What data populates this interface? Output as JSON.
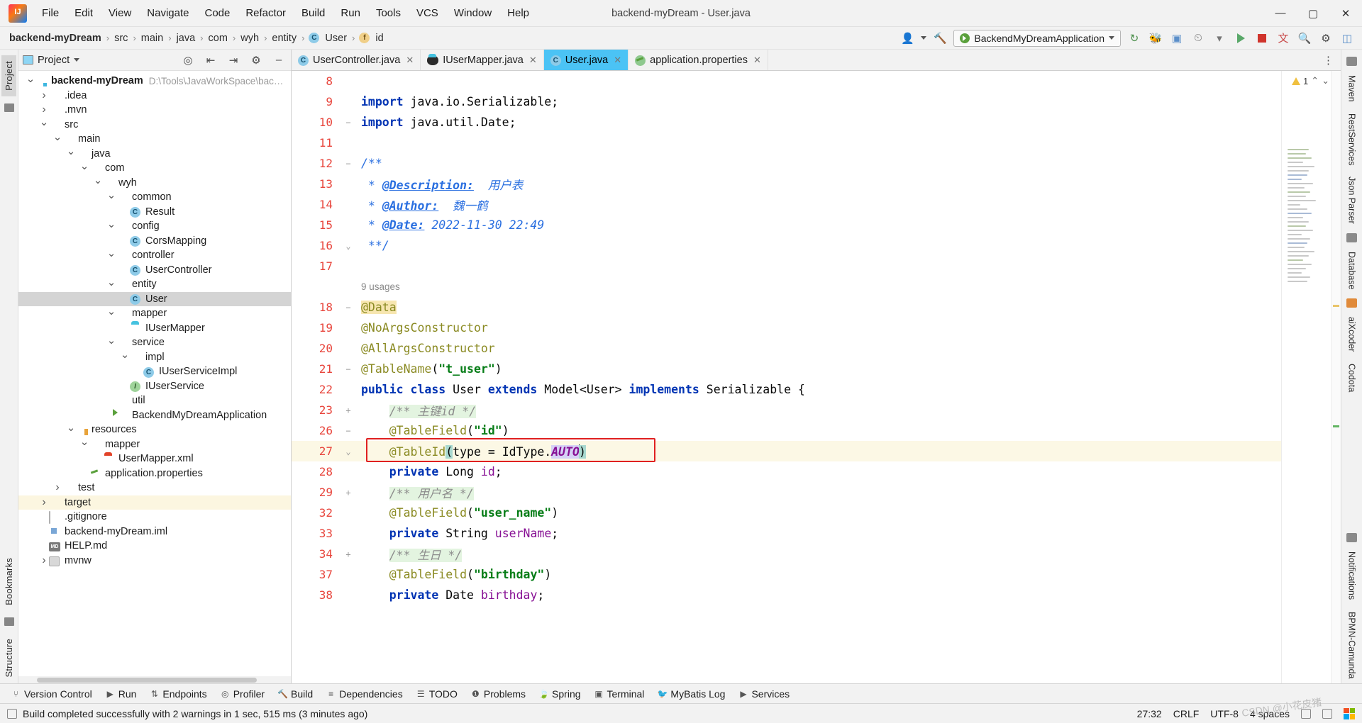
{
  "window": {
    "title": "backend-myDream - User.java",
    "logo_icon": "intellij-idea-logo",
    "minimize": "—",
    "maximize": "▢",
    "close": "✕"
  },
  "menu": [
    "File",
    "Edit",
    "View",
    "Navigate",
    "Code",
    "Refactor",
    "Build",
    "Run",
    "Tools",
    "VCS",
    "Window",
    "Help"
  ],
  "breadcrumb": {
    "items": [
      "backend-myDream",
      "src",
      "main",
      "java",
      "com",
      "wyh",
      "entity",
      "User",
      "id"
    ],
    "user_badge": "C",
    "id_badge": "f"
  },
  "toolbar": {
    "run_config": "BackendMyDreamApplication",
    "icons": [
      "account-icon",
      "hammer-icon",
      "spring-boot-icon",
      "chevron-down-icon",
      "sync-icon",
      "debug-icon",
      "coverage-icon",
      "profiler-icon",
      "run-icon",
      "stop-icon",
      "translate-icon",
      "search-icon",
      "settings-icon",
      "layout-icon"
    ]
  },
  "project_panel": {
    "title": "Project",
    "header_icons": [
      "locate-icon",
      "collapse-all-icon",
      "expand-all-icon",
      "settings-icon",
      "hide-icon"
    ],
    "tree": [
      {
        "depth": 0,
        "arrow": "down",
        "icon": "folder-module",
        "label": "backend-myDream",
        "bold": true,
        "path": "D:\\Tools\\JavaWorkSpace\\backend-my",
        "state": "normal"
      },
      {
        "depth": 1,
        "arrow": "right",
        "icon": "folder",
        "label": ".idea",
        "state": "normal"
      },
      {
        "depth": 1,
        "arrow": "right",
        "icon": "folder",
        "label": ".mvn",
        "state": "normal"
      },
      {
        "depth": 1,
        "arrow": "down",
        "icon": "folder",
        "label": "src",
        "state": "normal"
      },
      {
        "depth": 2,
        "arrow": "down",
        "icon": "folder",
        "label": "main",
        "state": "normal"
      },
      {
        "depth": 3,
        "arrow": "down",
        "icon": "folder-source",
        "label": "java",
        "state": "normal"
      },
      {
        "depth": 4,
        "arrow": "down",
        "icon": "folder-package",
        "label": "com",
        "state": "normal"
      },
      {
        "depth": 5,
        "arrow": "down",
        "icon": "folder-package",
        "label": "wyh",
        "state": "normal"
      },
      {
        "depth": 6,
        "arrow": "down",
        "icon": "folder-package",
        "label": "common",
        "state": "normal"
      },
      {
        "depth": 7,
        "arrow": "none",
        "icon": "class",
        "label": "Result",
        "state": "normal"
      },
      {
        "depth": 6,
        "arrow": "down",
        "icon": "folder-package",
        "label": "config",
        "state": "normal"
      },
      {
        "depth": 7,
        "arrow": "none",
        "icon": "class",
        "label": "CorsMapping",
        "state": "normal"
      },
      {
        "depth": 6,
        "arrow": "down",
        "icon": "folder-package",
        "label": "controller",
        "state": "normal"
      },
      {
        "depth": 7,
        "arrow": "none",
        "icon": "class",
        "label": "UserController",
        "state": "normal"
      },
      {
        "depth": 6,
        "arrow": "down",
        "icon": "folder-package",
        "label": "entity",
        "state": "normal"
      },
      {
        "depth": 7,
        "arrow": "none",
        "icon": "class",
        "label": "User",
        "state": "selected"
      },
      {
        "depth": 6,
        "arrow": "down",
        "icon": "folder-package",
        "label": "mapper",
        "state": "normal"
      },
      {
        "depth": 7,
        "arrow": "none",
        "icon": "mybatis-blue",
        "label": "IUserMapper",
        "state": "normal"
      },
      {
        "depth": 6,
        "arrow": "down",
        "icon": "folder-package",
        "label": "service",
        "state": "normal"
      },
      {
        "depth": 7,
        "arrow": "down",
        "icon": "folder-package",
        "label": "impl",
        "state": "normal"
      },
      {
        "depth": 8,
        "arrow": "none",
        "icon": "class",
        "label": "IUserServiceImpl",
        "state": "normal"
      },
      {
        "depth": 7,
        "arrow": "none",
        "icon": "interface",
        "label": "IUserService",
        "state": "normal"
      },
      {
        "depth": 6,
        "arrow": "none",
        "icon": "folder-package",
        "label": "util",
        "state": "normal"
      },
      {
        "depth": 6,
        "arrow": "none",
        "icon": "spring-app",
        "label": "BackendMyDreamApplication",
        "state": "normal"
      },
      {
        "depth": 3,
        "arrow": "down",
        "icon": "folder-resources",
        "label": "resources",
        "state": "normal"
      },
      {
        "depth": 4,
        "arrow": "down",
        "icon": "folder",
        "label": "mapper",
        "state": "normal"
      },
      {
        "depth": 5,
        "arrow": "none",
        "icon": "mybatis-red",
        "label": "UserMapper.xml",
        "state": "normal"
      },
      {
        "depth": 4,
        "arrow": "none",
        "icon": "properties",
        "label": "application.properties",
        "state": "normal"
      },
      {
        "depth": 2,
        "arrow": "right",
        "icon": "folder",
        "label": "test",
        "state": "normal"
      },
      {
        "depth": 1,
        "arrow": "right",
        "icon": "folder-target",
        "label": "target",
        "state": "highlight"
      },
      {
        "depth": 1,
        "arrow": "none",
        "icon": "gitignore",
        "label": ".gitignore",
        "state": "normal"
      },
      {
        "depth": 1,
        "arrow": "none",
        "icon": "iml",
        "label": "backend-myDream.iml",
        "state": "normal"
      },
      {
        "depth": 1,
        "arrow": "none",
        "icon": "markdown",
        "label": "HELP.md",
        "state": "normal"
      },
      {
        "depth": 1,
        "arrow": "right",
        "icon": "shell",
        "label": "mvnw",
        "state": "normal"
      }
    ]
  },
  "left_rail": {
    "tabs": [
      "Project"
    ],
    "icons": [
      "bookmarks-icon",
      "structure-icon"
    ],
    "bottom_labels": [
      "Bookmarks",
      "Structure"
    ]
  },
  "editor": {
    "tabs": [
      {
        "label": "UserController.java",
        "icon": "class-icon",
        "active": false,
        "closable": true
      },
      {
        "label": "IUserMapper.java",
        "icon": "mybatis-icon",
        "active": false,
        "closable": true
      },
      {
        "label": "User.java",
        "icon": "class-icon",
        "active": true,
        "closable": true
      },
      {
        "label": "application.properties",
        "icon": "properties-icon",
        "active": false,
        "closable": true
      }
    ],
    "warning_count": "1",
    "lines": [
      {
        "num": "8",
        "fold": "",
        "partial": true,
        "tokens": []
      },
      {
        "num": "9",
        "fold": "",
        "tokens": [
          {
            "t": "import ",
            "c": "kw"
          },
          {
            "t": "java.io.Serializable;",
            "c": "plain"
          }
        ]
      },
      {
        "num": "10",
        "fold": "minus",
        "tokens": [
          {
            "t": "import ",
            "c": "kw"
          },
          {
            "t": "java.util.Date;",
            "c": "plain"
          }
        ]
      },
      {
        "num": "11",
        "fold": "",
        "tokens": []
      },
      {
        "num": "12",
        "fold": "minus-top",
        "tokens": [
          {
            "t": "/**",
            "c": "jdoc"
          }
        ]
      },
      {
        "num": "13",
        "fold": "",
        "tokens": [
          {
            "t": " * ",
            "c": "jdoc"
          },
          {
            "t": "@Description:",
            "c": "jdoctag"
          },
          {
            "t": "  用户表",
            "c": "jdoc"
          }
        ]
      },
      {
        "num": "14",
        "fold": "",
        "tokens": [
          {
            "t": " * ",
            "c": "jdoc"
          },
          {
            "t": "@Author:",
            "c": "jdoctag"
          },
          {
            "t": "  魏一鹤",
            "c": "jdoc"
          }
        ]
      },
      {
        "num": "15",
        "fold": "",
        "tokens": [
          {
            "t": " * ",
            "c": "jdoc"
          },
          {
            "t": "@Date:",
            "c": "jdoctag"
          },
          {
            "t": " 2022-11-30 22:49",
            "c": "jdoc"
          }
        ]
      },
      {
        "num": "16",
        "fold": "minus-bot",
        "tokens": [
          {
            "t": " **/",
            "c": "jdoc"
          }
        ]
      },
      {
        "num": "17",
        "fold": "",
        "tokens": []
      },
      {
        "num": "",
        "fold": "",
        "usages": "9 usages"
      },
      {
        "num": "18",
        "fold": "minus-top",
        "tokens": [
          {
            "t": "@Data",
            "c": "ann",
            "bg": "hl-yellow"
          }
        ]
      },
      {
        "num": "19",
        "fold": "",
        "tokens": [
          {
            "t": "@NoArgsConstructor",
            "c": "ann"
          }
        ]
      },
      {
        "num": "20",
        "fold": "",
        "tokens": [
          {
            "t": "@AllArgsConstructor",
            "c": "ann"
          }
        ]
      },
      {
        "num": "21",
        "fold": "minus",
        "tokens": [
          {
            "t": "@TableName",
            "c": "ann"
          },
          {
            "t": "(",
            "c": "plain"
          },
          {
            "t": "\"t_user\"",
            "c": "str"
          },
          {
            "t": ")",
            "c": "plain"
          }
        ]
      },
      {
        "num": "22",
        "fold": "",
        "tokens": [
          {
            "t": "public class ",
            "c": "kw"
          },
          {
            "t": "User ",
            "c": "plain"
          },
          {
            "t": "extends ",
            "c": "kw"
          },
          {
            "t": "Model<User> ",
            "c": "plain"
          },
          {
            "t": "implements ",
            "c": "kw"
          },
          {
            "t": "Serializable {",
            "c": "plain"
          }
        ]
      },
      {
        "num": "23",
        "fold": "plus",
        "indent": 4,
        "tokens": [
          {
            "t": "/** 主键id */",
            "c": "cmt",
            "bg": "hl-green"
          }
        ]
      },
      {
        "num": "26",
        "fold": "minus-top",
        "indent": 4,
        "tokens": [
          {
            "t": "@TableField",
            "c": "ann"
          },
          {
            "t": "(",
            "c": "plain"
          },
          {
            "t": "\"id\"",
            "c": "str"
          },
          {
            "t": ")",
            "c": "plain"
          }
        ]
      },
      {
        "num": "27",
        "fold": "minus-bot",
        "indent": 4,
        "rowbg": "rowbg-y",
        "boxed": true,
        "tokens": [
          {
            "t": "@TableId",
            "c": "ann"
          },
          {
            "t": "(",
            "c": "plain",
            "bg": "hl-teal"
          },
          {
            "t": "type = IdType.",
            "c": "plain"
          },
          {
            "t": "AUTO",
            "c": "fld",
            "bg": "hl-lav",
            "italic": true
          },
          {
            "t": "|",
            "c": "caret"
          },
          {
            "t": ")",
            "c": "plain",
            "bg": "hl-teal"
          }
        ]
      },
      {
        "num": "28",
        "fold": "",
        "indent": 4,
        "tokens": [
          {
            "t": "private ",
            "c": "kw"
          },
          {
            "t": "Long ",
            "c": "plain"
          },
          {
            "t": "id",
            "c": "fld"
          },
          {
            "t": ";",
            "c": "plain"
          }
        ]
      },
      {
        "num": "29",
        "fold": "plus",
        "indent": 4,
        "tokens": [
          {
            "t": "/** 用户名 */",
            "c": "cmt",
            "bg": "hl-green"
          }
        ]
      },
      {
        "num": "32",
        "fold": "",
        "indent": 4,
        "tokens": [
          {
            "t": "@TableField",
            "c": "ann"
          },
          {
            "t": "(",
            "c": "plain"
          },
          {
            "t": "\"user_name\"",
            "c": "str"
          },
          {
            "t": ")",
            "c": "plain"
          }
        ]
      },
      {
        "num": "33",
        "fold": "",
        "indent": 4,
        "tokens": [
          {
            "t": "private ",
            "c": "kw"
          },
          {
            "t": "String ",
            "c": "plain"
          },
          {
            "t": "userName",
            "c": "fld"
          },
          {
            "t": ";",
            "c": "plain"
          }
        ]
      },
      {
        "num": "34",
        "fold": "plus",
        "indent": 4,
        "tokens": [
          {
            "t": "/** 生日 */",
            "c": "cmt",
            "bg": "hl-green"
          }
        ]
      },
      {
        "num": "37",
        "fold": "",
        "indent": 4,
        "tokens": [
          {
            "t": "@TableField",
            "c": "ann"
          },
          {
            "t": "(",
            "c": "plain"
          },
          {
            "t": "\"birthday\"",
            "c": "str"
          },
          {
            "t": ")",
            "c": "plain"
          }
        ]
      },
      {
        "num": "38",
        "fold": "",
        "indent": 4,
        "tokens": [
          {
            "t": "private ",
            "c": "kw"
          },
          {
            "t": "Date ",
            "c": "plain"
          },
          {
            "t": "birthday",
            "c": "fld"
          },
          {
            "t": ";",
            "c": "plain"
          }
        ]
      }
    ]
  },
  "right_rail": {
    "tabs": [
      "Maven",
      "RestServices",
      "Json Parser",
      "Database",
      "aiXcoder",
      "Codota",
      "Notifications",
      "BPMN-Camunda"
    ]
  },
  "bottom_tools": [
    {
      "label": "Version Control",
      "icon": "branch-icon"
    },
    {
      "label": "Run",
      "icon": "run-icon"
    },
    {
      "label": "Endpoints",
      "icon": "endpoints-icon"
    },
    {
      "label": "Profiler",
      "icon": "profiler-icon"
    },
    {
      "label": "Build",
      "icon": "build-icon"
    },
    {
      "label": "Dependencies",
      "icon": "dependencies-icon"
    },
    {
      "label": "TODO",
      "icon": "todo-icon"
    },
    {
      "label": "Problems",
      "icon": "problems-icon"
    },
    {
      "label": "Spring",
      "icon": "spring-icon"
    },
    {
      "label": "Terminal",
      "icon": "terminal-icon"
    },
    {
      "label": "MyBatis Log",
      "icon": "mybatis-icon"
    },
    {
      "label": "Services",
      "icon": "services-icon"
    }
  ],
  "status_bar": {
    "message": "Build completed successfully with 2 warnings in 1 sec, 515 ms (3 minutes ago)",
    "caret_position": "27:32",
    "line_separator": "CRLF",
    "encoding": "UTF-8",
    "indent": "4 spaces",
    "icons": [
      "lock-icon",
      "inspection-icon",
      "memory-icon"
    ],
    "watermark": "CSDN @小花皮猪"
  }
}
